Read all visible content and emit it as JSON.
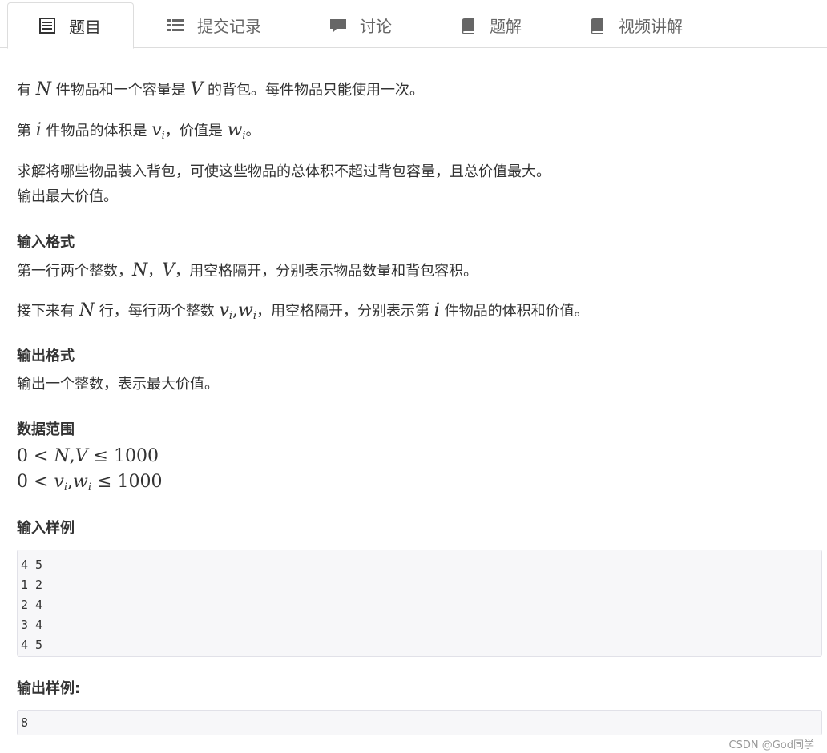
{
  "tabs": [
    {
      "label": "题目",
      "icon": "document-list-icon",
      "active": true
    },
    {
      "label": "提交记录",
      "icon": "list-icon",
      "active": false
    },
    {
      "label": "讨论",
      "icon": "chat-icon",
      "active": false
    },
    {
      "label": "题解",
      "icon": "book-icon",
      "active": false
    },
    {
      "label": "视频讲解",
      "icon": "book-icon",
      "active": false
    }
  ],
  "problem": {
    "p1_a": "有 ",
    "p1_N": "N",
    "p1_b": " 件物品和一个容量是 ",
    "p1_V": "V",
    "p1_c": " 的背包。每件物品只能使用一次。",
    "p2_a": "第 ",
    "p2_i": "i",
    "p2_b": " 件物品的体积是 ",
    "p2_v": "v",
    "p2_vi": "i",
    "p2_c": "，价值是 ",
    "p2_w": "w",
    "p2_wi": "i",
    "p2_d": "。",
    "p3": "求解将哪些物品装入背包，可使这些物品的总体积不超过背包容量，且总价值最大。",
    "p4": "输出最大价值。",
    "input_heading": "输入格式",
    "in1_a": "第一行两个整数，",
    "in1_N": "N",
    "in1_sep": "，",
    "in1_V": "V",
    "in1_b": "，用空格隔开，分别表示物品数量和背包容积。",
    "in2_a": "接下来有 ",
    "in2_N": "N",
    "in2_b": " 行，每行两个整数 ",
    "in2_v": "v",
    "in2_vi": "i",
    "in2_comma": ",",
    "in2_w": "w",
    "in2_wi": "i",
    "in2_c": "，用空格隔开，分别表示第 ",
    "in2_i": "i",
    "in2_d": " 件物品的体积和价值。",
    "output_heading": "输出格式",
    "out1": "输出一个整数，表示最大价值。",
    "range_heading": "数据范围",
    "r1_0": "0",
    "r1_lt": " < ",
    "r1_N": "N",
    "r1_c": ",",
    "r1_V": "V",
    "r1_le": " ≤ ",
    "r1_n": "1000",
    "r2_0": "0",
    "r2_lt": " < ",
    "r2_v": "v",
    "r2_vi": "i",
    "r2_c": ",",
    "r2_w": "w",
    "r2_wi": "i",
    "r2_le": " ≤ ",
    "r2_n": "1000",
    "sample_in_heading": "输入样例",
    "sample_in": [
      "4 5",
      "1 2",
      "2 4",
      "3 4",
      "4 5"
    ],
    "sample_out_heading": "输出样例:",
    "sample_out": [
      "8"
    ]
  },
  "watermark": "CSDN @God同学"
}
